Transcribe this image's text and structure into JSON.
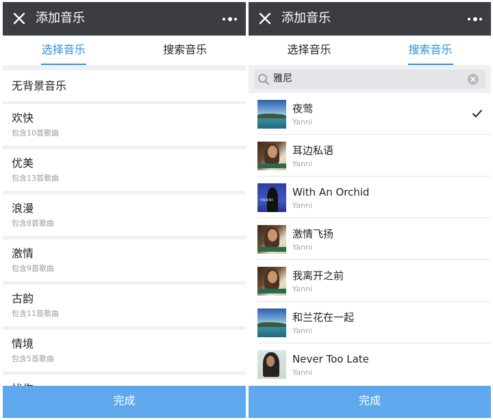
{
  "left": {
    "header": {
      "title": "添加音乐"
    },
    "tabs": [
      {
        "label": "选择音乐",
        "active": true
      },
      {
        "label": "搜索音乐",
        "active": false
      }
    ],
    "categories": [
      {
        "name": "无背景音乐",
        "sub": ""
      },
      {
        "name": "欢快",
        "sub": "包含10首歌曲"
      },
      {
        "name": "优美",
        "sub": "包含13首歌曲"
      },
      {
        "name": "浪漫",
        "sub": "包含8首歌曲"
      },
      {
        "name": "激情",
        "sub": "包含9首歌曲"
      },
      {
        "name": "古韵",
        "sub": "包含11首歌曲"
      },
      {
        "name": "情境",
        "sub": "包含5首歌曲"
      },
      {
        "name": "忧伤",
        "sub": ""
      }
    ],
    "done_label": "完成"
  },
  "right": {
    "header": {
      "title": "添加音乐"
    },
    "tabs": [
      {
        "label": "选择音乐",
        "active": false
      },
      {
        "label": "搜索音乐",
        "active": true
      }
    ],
    "search": {
      "value": "雅尼"
    },
    "cover_text": {
      "orchid": "YANNI"
    },
    "songs": [
      {
        "title": "夜莺",
        "artist": "Yanni",
        "cover": "sea",
        "selected": true
      },
      {
        "title": "耳边私语",
        "artist": "Yanni",
        "cover": "portrait",
        "selected": false
      },
      {
        "title": "With An Orchid",
        "artist": "Yanni",
        "cover": "orchid",
        "selected": false
      },
      {
        "title": "激情飞扬",
        "artist": "Yanni",
        "cover": "portrait",
        "selected": false
      },
      {
        "title": "我离开之前",
        "artist": "Yanni",
        "cover": "portrait",
        "selected": false
      },
      {
        "title": "和兰花在一起",
        "artist": "Yanni",
        "cover": "sea",
        "selected": false
      },
      {
        "title": "Never Too Late",
        "artist": "Yanni",
        "cover": "lastcov",
        "selected": false
      }
    ],
    "done_label": "完成"
  },
  "colors": {
    "header_bg": "#3b3d43",
    "accent": "#2a8ee0",
    "done_bar": "#5fa8ee",
    "list_bg": "#efeff4"
  },
  "icons": {
    "close": "close-icon",
    "more": "more-dots-icon",
    "search": "search-icon",
    "clear": "clear-icon",
    "check": "check-icon"
  }
}
